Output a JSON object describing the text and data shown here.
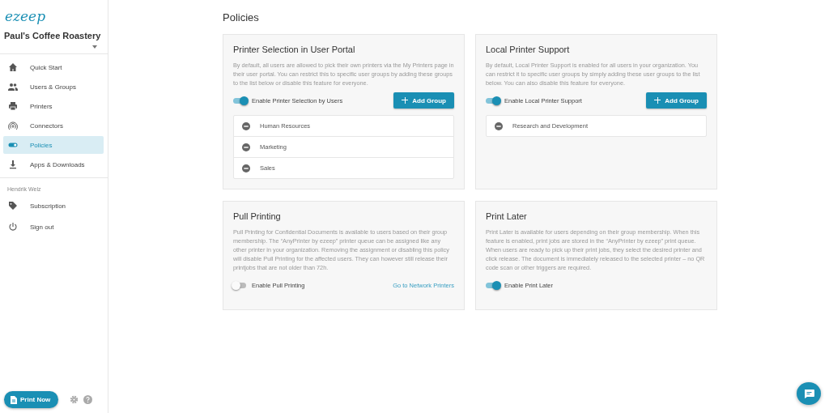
{
  "sidebar": {
    "logo": "ezeep",
    "organization": "Paul's Coffee Roastery",
    "items": [
      {
        "label": "Quick Start",
        "selected": false
      },
      {
        "label": "Users & Groups",
        "selected": false
      },
      {
        "label": "Printers",
        "selected": false
      },
      {
        "label": "Connectors",
        "selected": false
      },
      {
        "label": "Policies",
        "selected": true
      },
      {
        "label": "Apps & Downloads",
        "selected": false
      }
    ],
    "user_name": "Hendrik Welz",
    "account_items": [
      {
        "label": "Subscription"
      },
      {
        "label": "Sign out"
      }
    ],
    "print_button": "Print Now"
  },
  "page_title": "Policies",
  "cards": [
    {
      "title": "Printer Selection in User Portal",
      "description": "By default, all users are allowed to pick their own printers via the My Printers page in their user portal. You can restrict this to specific user groups by adding these groups to the list below or disable this feature for everyone.",
      "toggle": {
        "label": "Enable Printer Selection by Users",
        "on": true
      },
      "add_button": "Add Group",
      "groups": [
        "Human Resources",
        "Marketing",
        "Sales"
      ]
    },
    {
      "title": "Local Printer Support",
      "description": "By default, Local Printer Support is enabled for all users in your organization. You can restrict it to specific user groups by simply adding these user groups to the list below. You can also disable this feature for everyone.",
      "toggle": {
        "label": "Enable Local Printer Support",
        "on": true
      },
      "add_button": "Add Group",
      "groups": [
        "Research and Development"
      ]
    },
    {
      "title": "Pull Printing",
      "description": "Pull Printing for Confidential Documents is available to users based on their group membership. The “AnyPrinter by ezeep” printer queue can be assigned like any other printer in your organization. Removing the assignment or disabling this policy will disable Pull Printing for the affected users. They can however still release their printjobs that are not older than 72h.",
      "toggle": {
        "label": "Enable Pull Printing",
        "on": false
      },
      "link": "Go to Network Printers"
    },
    {
      "title": "Print Later",
      "description": "Print Later is available for users depending on their group membership. When this feature is enabled, print jobs are stored in the “AnyPrinter by ezeep” print queue. When users are ready to pick up their print jobs, they select the desired printer and click release. The document is immediately released to the selected printer – no QR code scan or other triggers are required.",
      "toggle": {
        "label": "Enable Print Later",
        "on": true
      }
    }
  ]
}
